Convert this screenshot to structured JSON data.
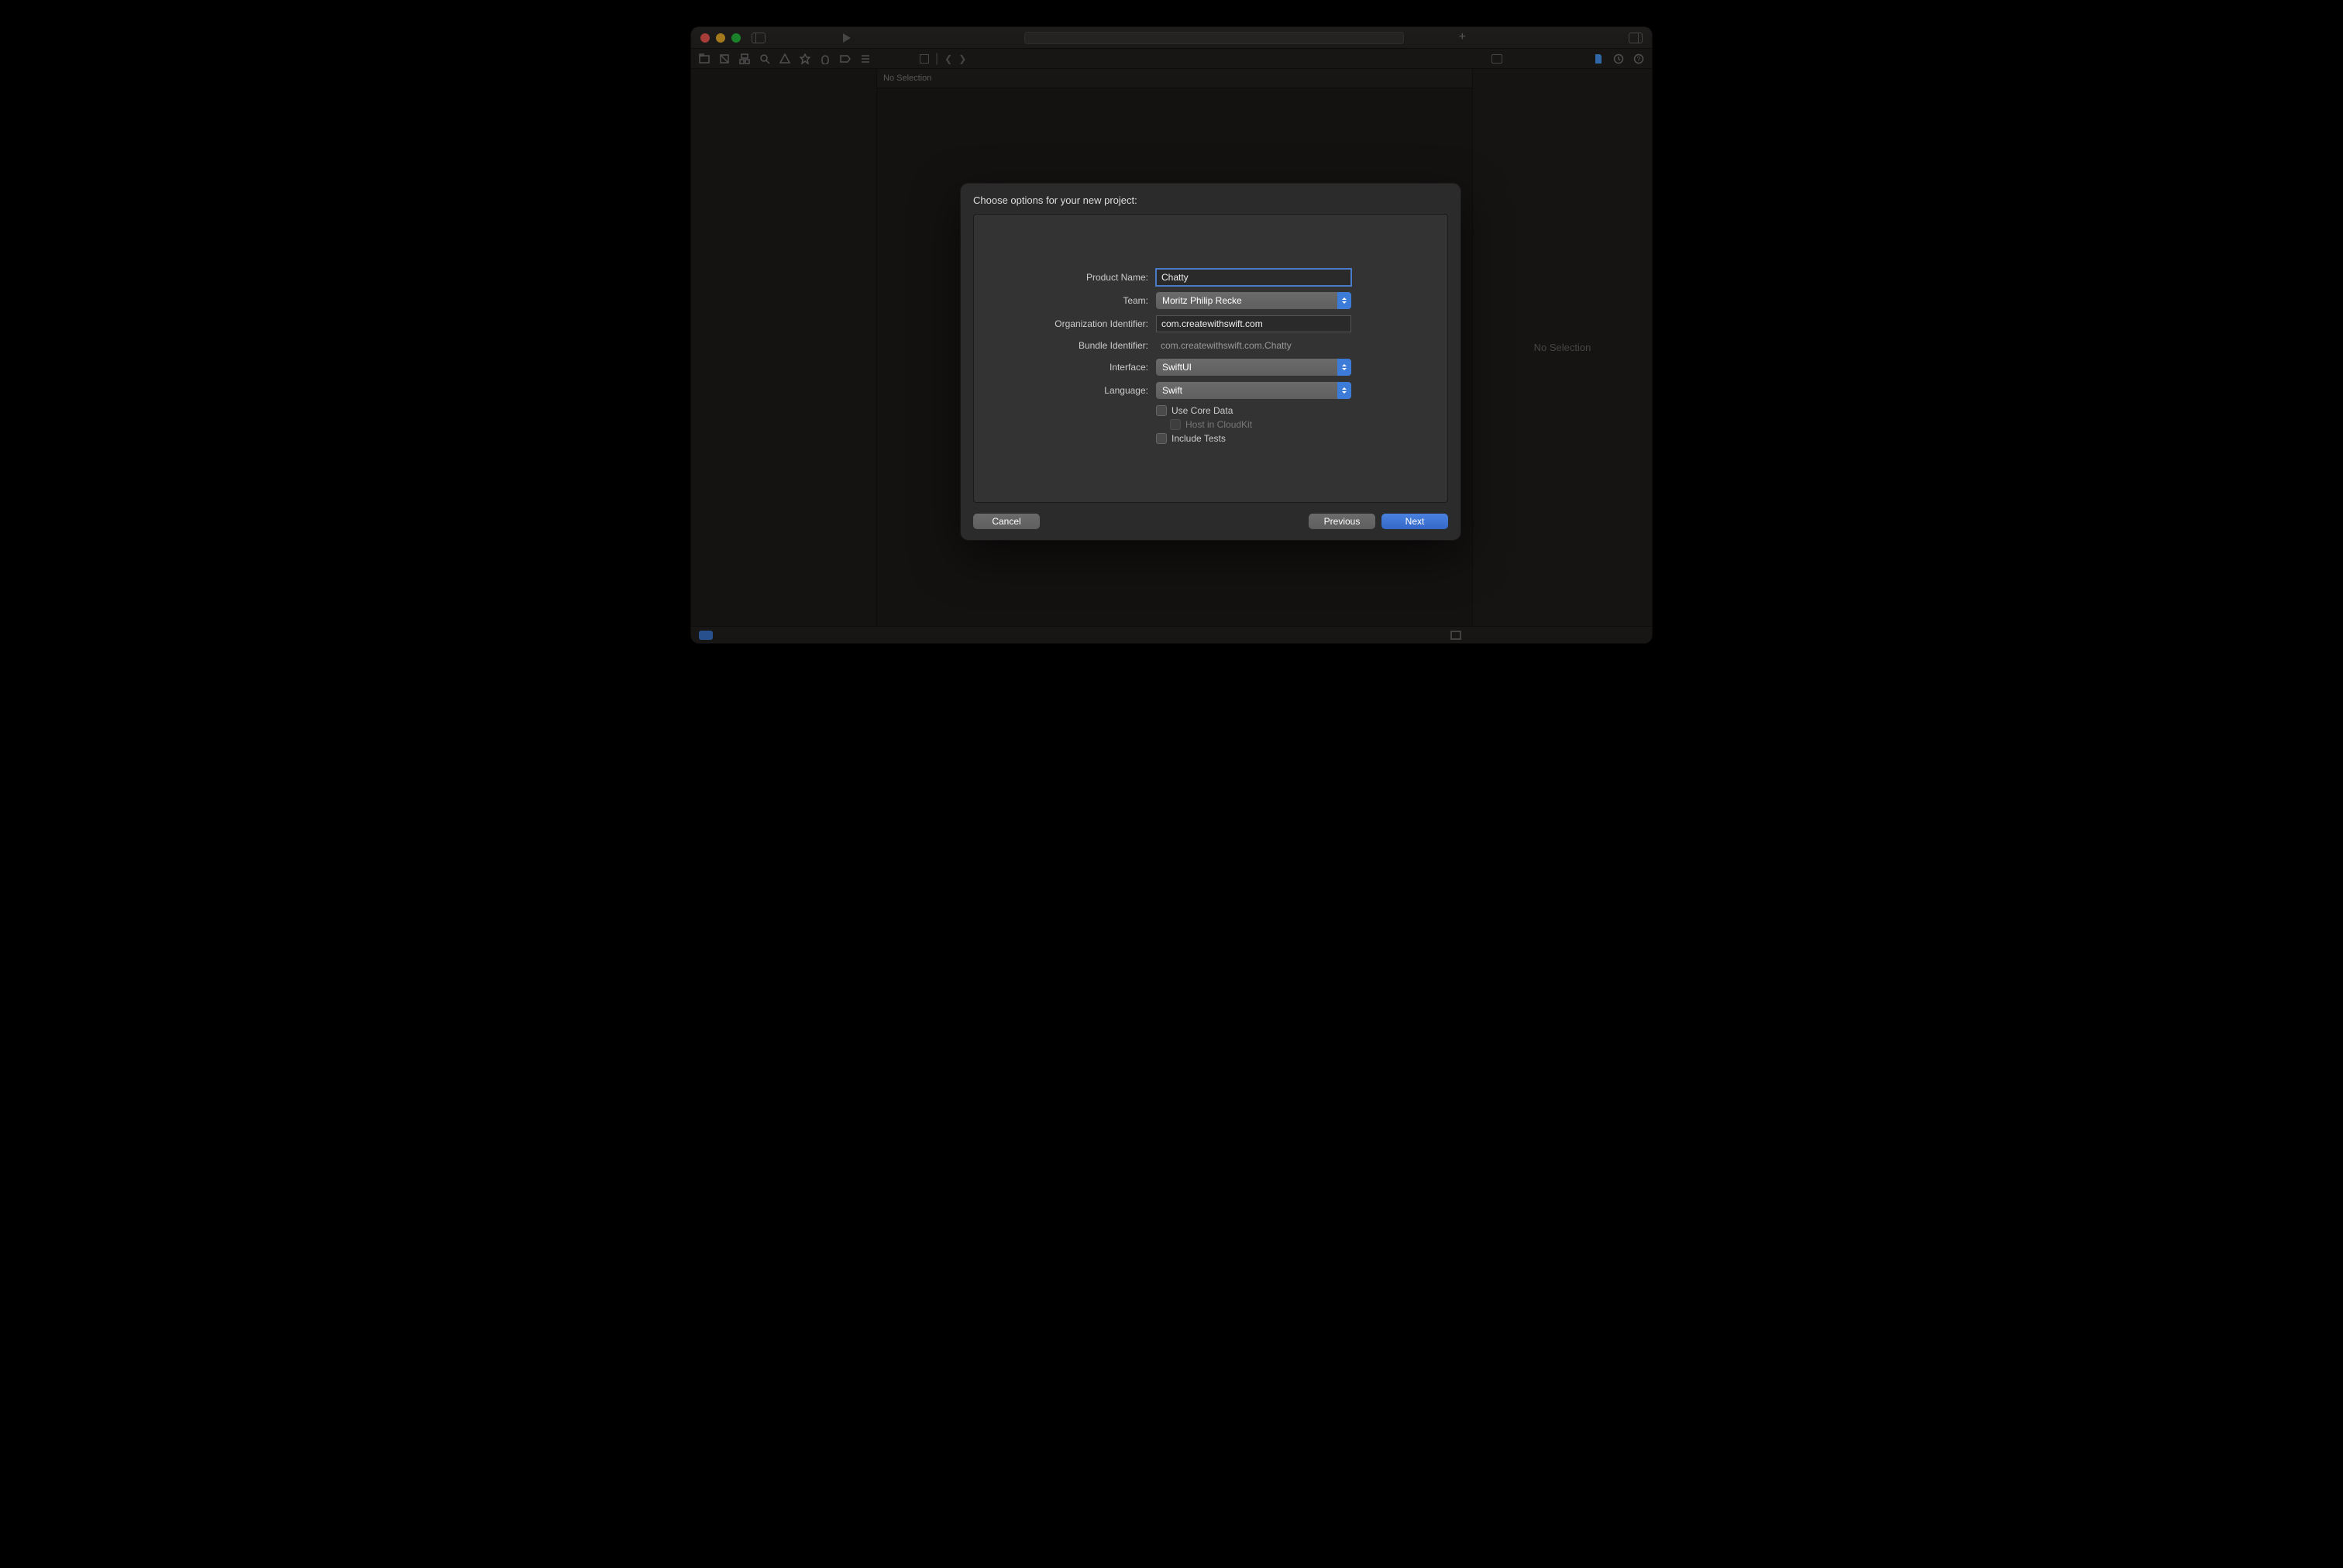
{
  "editor": {
    "no_selection_top": "No Selection"
  },
  "inspector": {
    "no_selection": "No Selection"
  },
  "sheet": {
    "title": "Choose options for your new project:",
    "labels": {
      "product_name": "Product Name:",
      "team": "Team:",
      "org_identifier": "Organization Identifier:",
      "bundle_identifier": "Bundle Identifier:",
      "interface": "Interface:",
      "language": "Language:"
    },
    "values": {
      "product_name": "Chatty",
      "team": "Moritz Philip Recke",
      "org_identifier": "com.createwithswift.com",
      "bundle_identifier": "com.createwithswift.com.Chatty",
      "interface": "SwiftUI",
      "language": "Swift"
    },
    "checkboxes": {
      "core_data": "Use Core Data",
      "cloudkit": "Host in CloudKit",
      "include_tests": "Include Tests"
    },
    "buttons": {
      "cancel": "Cancel",
      "previous": "Previous",
      "next": "Next"
    }
  }
}
